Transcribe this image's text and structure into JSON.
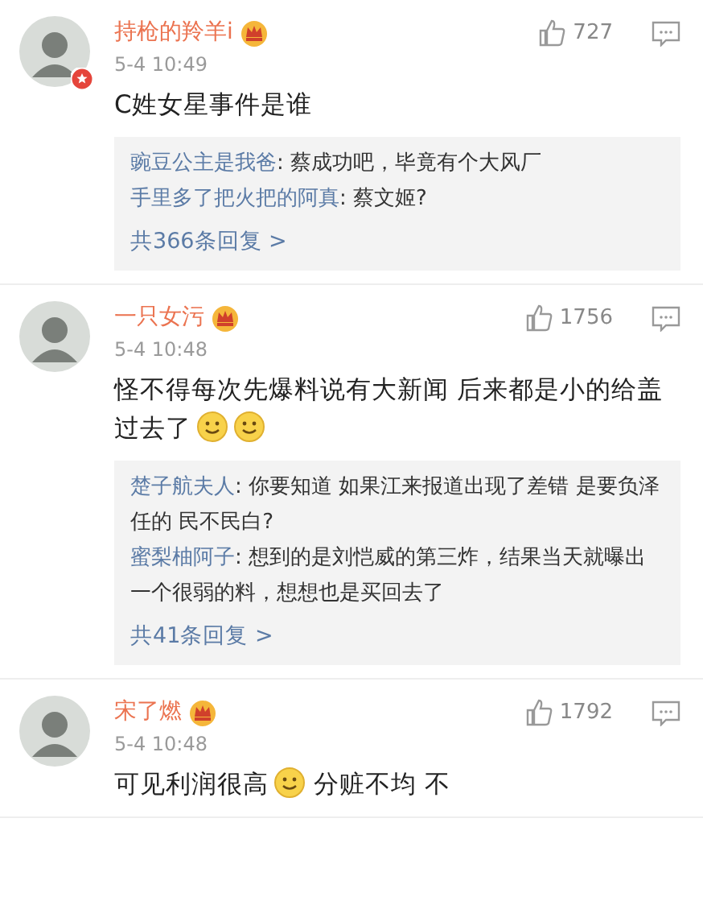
{
  "comments": [
    {
      "user": "持枪的羚羊i",
      "avatar_badge": true,
      "time": "5-4 10:49",
      "likes": "727",
      "body": [
        {
          "kind": "text",
          "text": "C姓女星事件是谁"
        }
      ],
      "replies": [
        {
          "user": "豌豆公主是我爸",
          "text": ": 蔡成功吧，毕竟有个大风厂"
        },
        {
          "user": "手里多了把火把的阿真",
          "text": ": 蔡文姬?"
        }
      ],
      "more": "共366条回复 >"
    },
    {
      "user": "一只女污",
      "avatar_badge": false,
      "time": "5-4 10:48",
      "likes": "1756",
      "body": [
        {
          "kind": "text",
          "text": "怪不得每次先爆料说有大新闻 后来都是小的给盖过去了"
        },
        {
          "kind": "emoji"
        },
        {
          "kind": "emoji"
        }
      ],
      "replies": [
        {
          "user": "楚子航夫人",
          "text": ": 你要知道 如果江来报道出现了差错 是要负泽任的 民不民白?"
        },
        {
          "user": "蜜梨柚阿子",
          "text": ": 想到的是刘恺威的第三炸，结果当天就曝出一个很弱的料，想想也是买回去了"
        }
      ],
      "more": "共41条回复 >"
    },
    {
      "user": "宋了燃",
      "avatar_badge": false,
      "time": "5-4 10:48",
      "likes": "1792",
      "body": [
        {
          "kind": "text",
          "text": "可见利润很高"
        },
        {
          "kind": "emoji"
        },
        {
          "kind": "text",
          "text": " 分赃不均 不"
        }
      ]
    }
  ]
}
